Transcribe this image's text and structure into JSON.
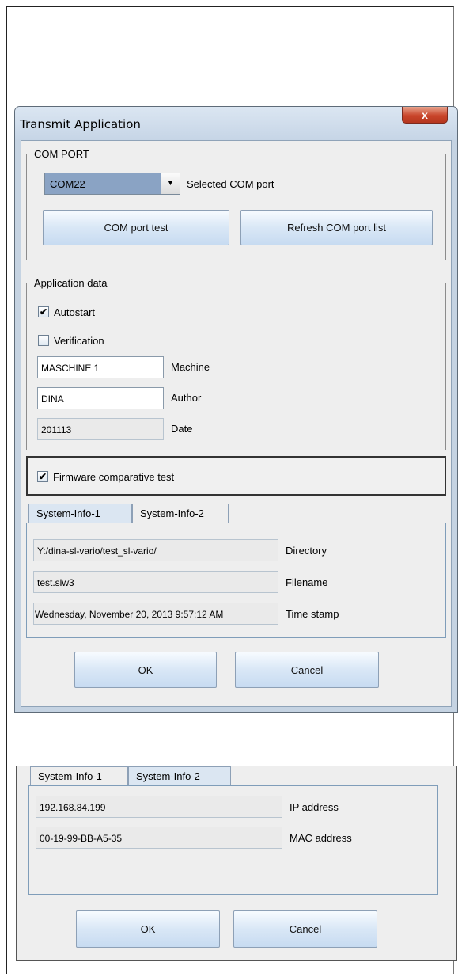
{
  "dialog": {
    "title": "Transmit Application",
    "close_symbol": "x",
    "com_port": {
      "legend": "COM PORT",
      "selected_value": "COM22",
      "selected_label": "Selected COM port",
      "test_button": "COM port test",
      "refresh_button": "Refresh COM port list"
    },
    "app_data": {
      "legend": "Application data",
      "autostart_label": "Autostart",
      "autostart_checked": true,
      "verification_label": "Verification",
      "verification_checked": false,
      "machine_value": "MASCHINE 1",
      "machine_label": "Machine",
      "author_value": "DINA",
      "author_label": "Author",
      "date_value": "201113",
      "date_label": "Date"
    },
    "firmware_label": "Firmware comparative test",
    "firmware_checked": true,
    "tabs": [
      "System-Info-1",
      "System-Info-2"
    ],
    "sysinfo1": {
      "directory_value": "Y:/dina-sl-vario/test_sl-vario/",
      "directory_label": "Directory",
      "filename_value": "test.slw3",
      "filename_label": "Filename",
      "timestamp_value": "Wednesday, November 20, 2013 9:57:12 AM",
      "timestamp_label": "Time stamp"
    },
    "ok_button": "OK",
    "cancel_button": "Cancel"
  },
  "panel2": {
    "tabs": [
      "System-Info-1",
      "System-Info-2"
    ],
    "ip_value": "192.168.84.199",
    "ip_label": "IP address",
    "mac_value": "00-19-99-BB-A5-35",
    "mac_label": "MAC address",
    "ok_button": "OK",
    "cancel_button": "Cancel"
  },
  "icons": {
    "checkmark": "check-icon",
    "dropdown": "chevron-down-icon"
  }
}
